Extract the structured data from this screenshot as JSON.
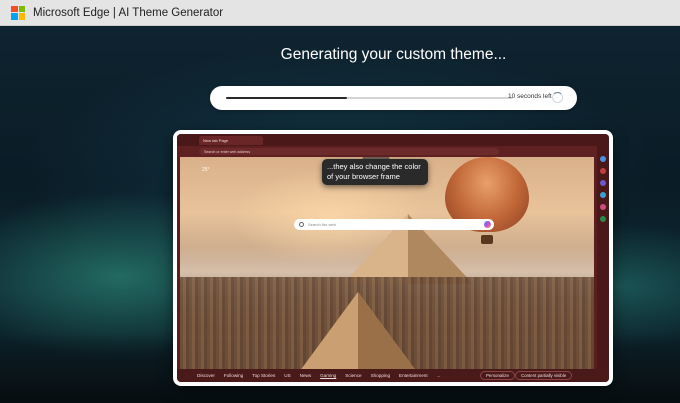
{
  "app": {
    "title": "Microsoft Edge | AI Theme Generator"
  },
  "main": {
    "heading": "Generating your custom theme...",
    "progress": {
      "fraction": 0.42,
      "status_text": "10 seconds left"
    }
  },
  "preview": {
    "tab_label": "New tab Page",
    "address_placeholder": "Search or enter web address",
    "tooltip_text": "...they also change the color of your browser frame",
    "search_placeholder": "Search the web",
    "weather_text": "25°",
    "nav_items": [
      "Discover",
      "Following",
      "Top Stories",
      "US",
      "News",
      "Gaming",
      "Science",
      "Shopping",
      "Entertainment",
      "..."
    ],
    "active_nav": "Gaming",
    "personalize_label": "Personalize",
    "content_label": "Content partially visible"
  },
  "colors": {
    "frame": "#5a1e1e",
    "accent_progress": "#2a2a2a"
  }
}
